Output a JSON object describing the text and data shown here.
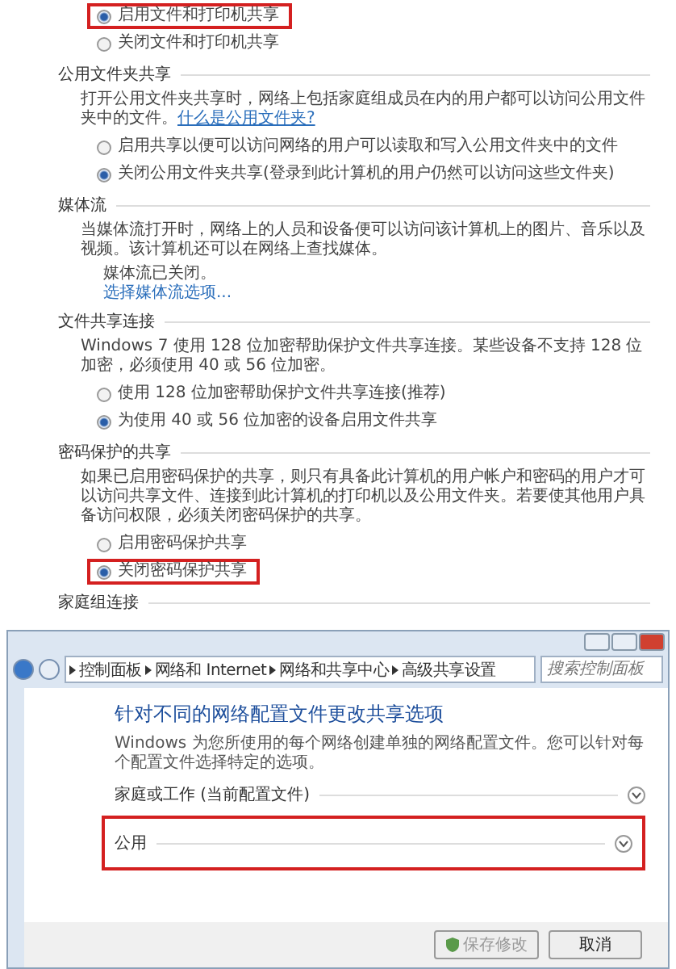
{
  "sharing_settings": {
    "sections": [
      {
        "options": [
          {
            "label": "启用文件和打印机共享",
            "selected": true,
            "highlighted": true
          },
          {
            "label": "关闭文件和打印机共享",
            "selected": false,
            "highlighted": false
          }
        ]
      },
      {
        "heading": "公用文件夹共享",
        "description": "打开公用文件夹共享时，网络上包括家庭组成员在内的用户都可以访问公用文件夹中的文件。",
        "description_link": "什么是公用文件夹?",
        "options": [
          {
            "label": "启用共享以便可以访问网络的用户可以读取和写入公用文件夹中的文件",
            "selected": false,
            "highlighted": false
          },
          {
            "label": "关闭公用文件夹共享(登录到此计算机的用户仍然可以访问这些文件夹)",
            "selected": true,
            "highlighted": false
          }
        ]
      },
      {
        "heading": "媒体流",
        "description": "当媒体流打开时，网络上的人员和设备便可以访问该计算机上的图片、音乐以及视频。该计算机还可以在网络上查找媒体。",
        "status": "媒体流已关闭。",
        "link": "选择媒体流选项..."
      },
      {
        "heading": "文件共享连接",
        "description": "Windows 7 使用 128 位加密帮助保护文件共享连接。某些设备不支持 128 位加密，必须使用 40 或 56 位加密。",
        "options": [
          {
            "label": "使用 128 位加密帮助保护文件共享连接(推荐)",
            "selected": false,
            "highlighted": false
          },
          {
            "label": "为使用 40 或 56 位加密的设备启用文件共享",
            "selected": true,
            "highlighted": false
          }
        ]
      },
      {
        "heading": "密码保护的共享",
        "description": "如果已启用密码保护的共享，则只有具备此计算机的用户帐户和密码的用户才可以访问共享文件、连接到此计算机的打印机以及公用文件夹。若要使其他用户具备访问权限，必须关闭密码保护的共享。",
        "options": [
          {
            "label": "启用密码保护共享",
            "selected": false,
            "highlighted": false
          },
          {
            "label": "关闭密码保护共享",
            "selected": true,
            "highlighted": true
          }
        ]
      },
      {
        "heading": "家庭组连接"
      }
    ]
  },
  "window": {
    "breadcrumb": [
      "控制面板",
      "网络和 Internet",
      "网络和共享中心",
      "高级共享设置"
    ],
    "search": {
      "placeholder": "搜索控制面板"
    },
    "title": "针对不同的网络配置文件更改共享选项",
    "subtitle": "Windows 为您所使用的每个网络创建单独的网络配置文件。您可以针对每个配置文件选择特定的选项。",
    "profiles": [
      {
        "label": "家庭或工作 (当前配置文件)",
        "highlighted": false
      },
      {
        "label": "公用",
        "highlighted": true
      }
    ],
    "buttons": [
      {
        "label": "保存修改",
        "kind": "save",
        "disabled": true
      },
      {
        "label": "取消",
        "kind": "cancel",
        "disabled": false
      }
    ]
  }
}
